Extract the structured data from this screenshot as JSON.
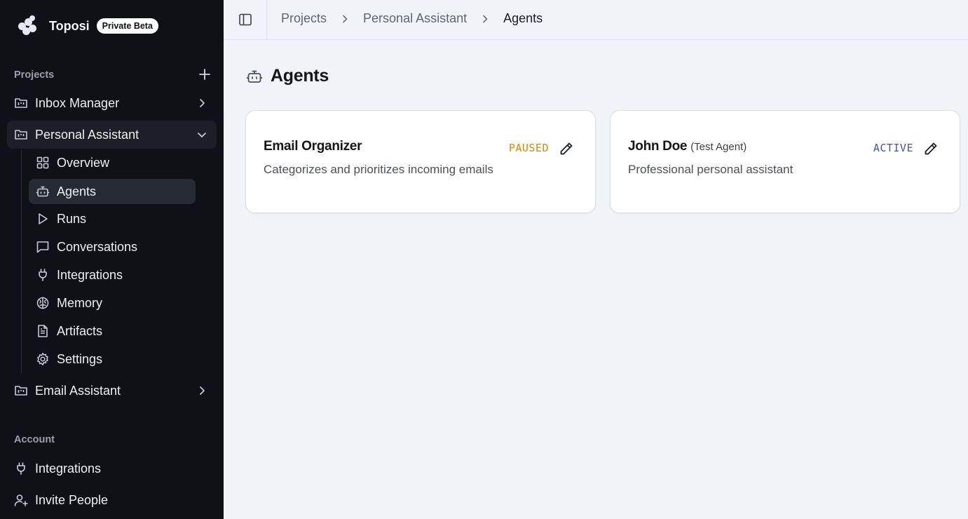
{
  "brand": {
    "name": "Toposi",
    "badge": "Private Beta"
  },
  "sidebar": {
    "projects_label": "Projects",
    "projects": [
      {
        "label": "Inbox Manager",
        "expanded": false
      },
      {
        "label": "Personal Assistant",
        "expanded": true
      },
      {
        "label": "Email Assistant",
        "expanded": false
      }
    ],
    "subitems": [
      {
        "label": "Overview",
        "icon": "grid-icon"
      },
      {
        "label": "Agents",
        "icon": "bot-icon"
      },
      {
        "label": "Runs",
        "icon": "play-icon"
      },
      {
        "label": "Conversations",
        "icon": "message-icon"
      },
      {
        "label": "Integrations",
        "icon": "plug-icon"
      },
      {
        "label": "Memory",
        "icon": "brain-icon"
      },
      {
        "label": "Artifacts",
        "icon": "document-icon"
      },
      {
        "label": "Settings",
        "icon": "gear-icon"
      }
    ],
    "account_label": "Account",
    "account_items": [
      {
        "label": "Integrations",
        "icon": "plug-icon"
      },
      {
        "label": "Invite People",
        "icon": "user-plus-icon"
      }
    ]
  },
  "breadcrumb": [
    "Projects",
    "Personal Assistant",
    "Agents"
  ],
  "page": {
    "title": "Agents"
  },
  "agents": [
    {
      "name": "Email Organizer",
      "suffix": "",
      "description": "Categorizes and prioritizes incoming emails",
      "status": "PAUSED",
      "status_color": "#d68a06"
    },
    {
      "name": "John Doe",
      "suffix": "(Test Agent)",
      "description": "Professional personal assistant",
      "status": "ACTIVE",
      "status_color": "#3b57b8"
    }
  ]
}
